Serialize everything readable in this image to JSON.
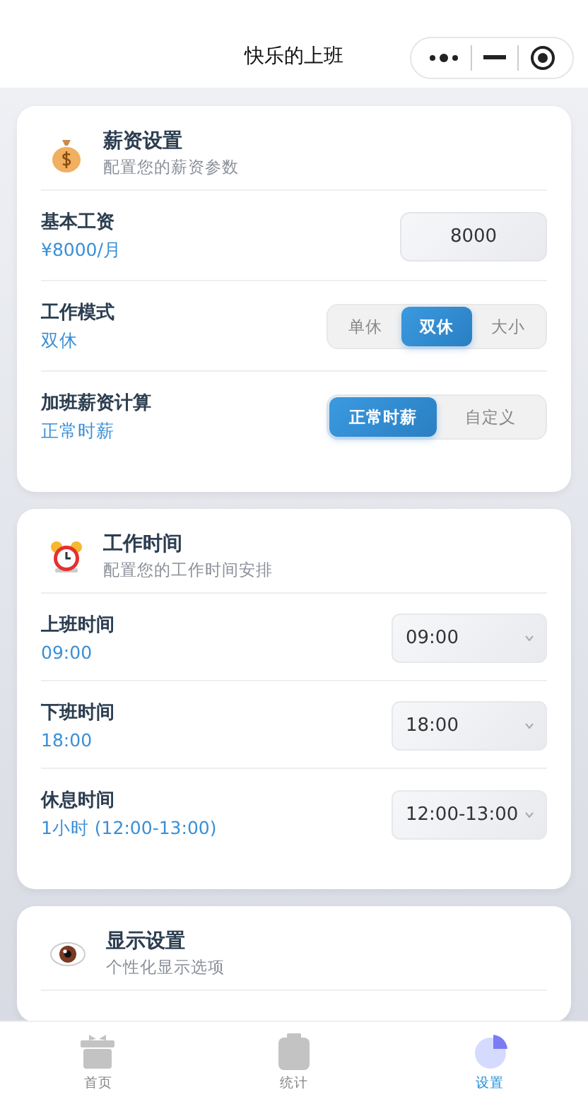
{
  "nav": {
    "title": "快乐的上班"
  },
  "sections": [
    {
      "title": "薪资设置",
      "subtitle": "配置您的薪资参数",
      "rows": [
        {
          "label": "基本工资",
          "value": "¥8000/月",
          "control": {
            "kind": "input",
            "value": "8000"
          }
        },
        {
          "label": "工作模式",
          "value": "双休",
          "control": {
            "kind": "segmented",
            "options": [
              {
                "label": "单休",
                "selected": false
              },
              {
                "label": "双休",
                "selected": true
              },
              {
                "label": "大小",
                "selected": false
              }
            ]
          }
        },
        {
          "label": "加班薪资计算",
          "value": "正常时薪",
          "control": {
            "kind": "segmented",
            "options": [
              {
                "label": "正常时薪",
                "selected": true
              },
              {
                "label": "自定义",
                "selected": false
              }
            ]
          }
        }
      ]
    },
    {
      "title": "工作时间",
      "subtitle": "配置您的工作时间安排",
      "rows": [
        {
          "label": "上班时间",
          "value": "09:00",
          "control": {
            "kind": "select",
            "value": "09:00"
          }
        },
        {
          "label": "下班时间",
          "value": "18:00",
          "control": {
            "kind": "select",
            "value": "18:00"
          }
        },
        {
          "label": "休息时间",
          "value": "1小时 (12:00-13:00)",
          "control": {
            "kind": "select",
            "value": "12:00-13:00"
          }
        }
      ]
    },
    {
      "title": "显示设置",
      "subtitle": "个性化显示选项"
    }
  ],
  "tabbar": [
    {
      "label": "首页",
      "selected": false
    },
    {
      "label": "统计",
      "selected": false
    },
    {
      "label": "设置",
      "selected": true
    }
  ]
}
